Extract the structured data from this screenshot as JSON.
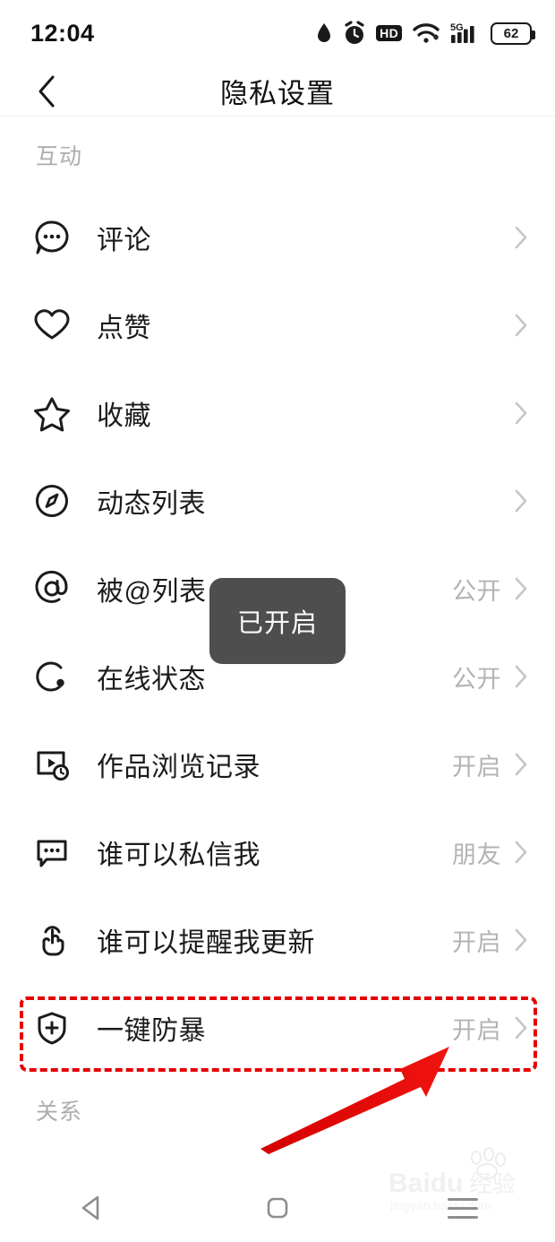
{
  "status_bar": {
    "time": "12:04",
    "icons": [
      "water-drop-icon",
      "alarm-clock-icon",
      "hd-icon",
      "wifi-icon",
      "5g-signal-icon",
      "battery-icon"
    ],
    "hd_label": "HD",
    "network_label": "5G",
    "battery_level": "62"
  },
  "app_bar": {
    "back_icon": "chevron-left-icon",
    "title": "隐私设置"
  },
  "sections": [
    {
      "title": "互动",
      "items": [
        {
          "icon": "comment-bubble-icon",
          "label": "评论",
          "value": ""
        },
        {
          "icon": "heart-icon",
          "label": "点赞",
          "value": ""
        },
        {
          "icon": "star-icon",
          "label": "收藏",
          "value": ""
        },
        {
          "icon": "compass-icon",
          "label": "动态列表",
          "value": ""
        },
        {
          "icon": "at-mention-icon",
          "label": "被@列表",
          "value": "公开"
        },
        {
          "icon": "online-status-icon",
          "label": "在线状态",
          "value": "公开"
        },
        {
          "icon": "video-history-icon",
          "label": "作品浏览记录",
          "value": "开启"
        },
        {
          "icon": "message-box-icon",
          "label": "谁可以私信我",
          "value": "朋友"
        },
        {
          "icon": "tap-hand-icon",
          "label": "谁可以提醒我更新",
          "value": "开启"
        },
        {
          "icon": "shield-plus-icon",
          "label": "一键防暴",
          "value": "开启"
        }
      ]
    },
    {
      "title": "关系",
      "items": []
    }
  ],
  "toast": {
    "text": "已开启"
  },
  "annotation": {
    "highlight_target": "一键防暴",
    "highlight_color": "#e60000",
    "arrow_color": "#e8110d"
  },
  "watermark": {
    "brand": "Baidu",
    "suffix": "经验",
    "url": "jingyan.baidu.com"
  },
  "system_nav": {
    "back": "back-triangle-icon",
    "home": "home-square-icon",
    "recents": "recents-menu-icon"
  }
}
